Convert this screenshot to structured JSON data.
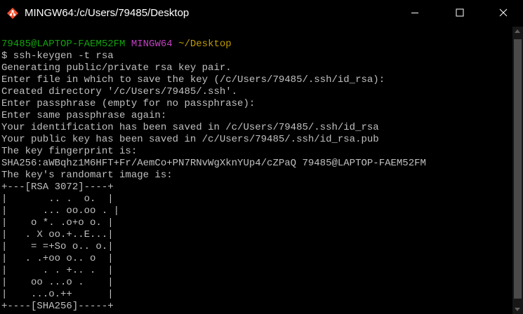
{
  "window": {
    "title": "MINGW64:/c/Users/79485/Desktop",
    "icon": "git-bash-icon",
    "controls": {
      "minimize": "minimize-icon",
      "maximize": "maximize-icon",
      "close": "close-icon"
    }
  },
  "colors": {
    "background": "#000000",
    "text": "#c0c0c0",
    "prompt_user": "#13a10e",
    "prompt_host": "#c040c0",
    "prompt_path": "#c19c00"
  },
  "terminal": {
    "prompt": {
      "user_host": "79485@LAPTOP-FAEM52FM",
      "env": "MINGW64",
      "path": "~/Desktop"
    },
    "command_line": "$ ssh-keygen -t rsa",
    "output": [
      "Generating public/private rsa key pair.",
      "Enter file in which to save the key (/c/Users/79485/.ssh/id_rsa):",
      "Created directory '/c/Users/79485/.ssh'.",
      "Enter passphrase (empty for no passphrase):",
      "Enter same passphrase again:",
      "Your identification has been saved in /c/Users/79485/.ssh/id_rsa",
      "Your public key has been saved in /c/Users/79485/.ssh/id_rsa.pub",
      "The key fingerprint is:",
      "SHA256:aWBqhz1M6HFT+Fr/AemCo+PN7RNvWgXknYUp4/cZPaQ 79485@LAPTOP-FAEM52FM",
      "The key's randomart image is:",
      "+---[RSA 3072]----+",
      "|       .. .  o.  |",
      "|      ... oo.oo . |",
      "|    o *. .o+o o. |",
      "|   . X oo.+..E...|",
      "|    = =+So o.. o.|",
      "|   . .+oo o.. o  |",
      "|      . . +.. .  |",
      "|    oo ...o .    |",
      "|    ...o.++      |",
      "+----[SHA256]-----+"
    ]
  }
}
